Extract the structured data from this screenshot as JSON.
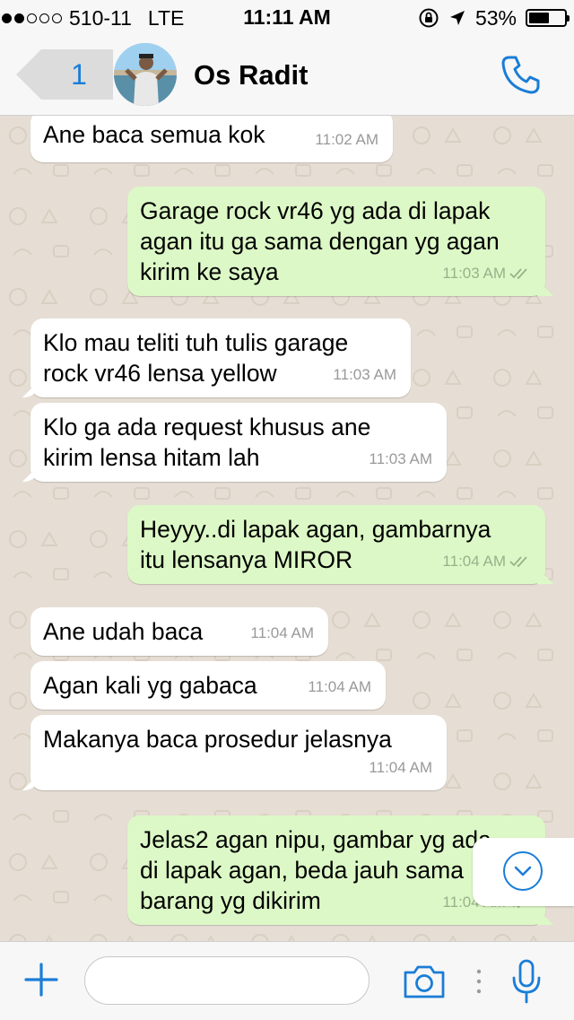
{
  "status_bar": {
    "carrier": "510-11",
    "network": "LTE",
    "time": "11:11 AM",
    "battery": "53%",
    "signal_bars_filled": 2,
    "signal_bars_total": 5
  },
  "header": {
    "back_count": "1",
    "contact_name": "Os Radit"
  },
  "messages": [
    {
      "direction": "in",
      "lines": [
        "Ane baca semua kok"
      ],
      "time": "11:02 AM"
    },
    {
      "direction": "out",
      "lines": [
        "Garage rock vr46 yg ada di lapak",
        "agan itu ga sama dengan yg agan",
        "kirim ke saya"
      ],
      "time": "11:03 AM",
      "read": true
    },
    {
      "direction": "in",
      "lines": [
        "Klo mau teliti tuh tulis garage",
        "rock vr46 lensa yellow"
      ],
      "time": "11:03 AM"
    },
    {
      "direction": "in",
      "lines": [
        "Klo ga ada request khusus ane",
        "kirim lensa hitam lah"
      ],
      "time": "11:03 AM"
    },
    {
      "direction": "out",
      "lines": [
        "Heyyy..di lapak agan, gambarnya",
        "itu lensanya MIROR"
      ],
      "time": "11:04 AM",
      "read": true
    },
    {
      "direction": "in",
      "lines": [
        "Ane udah baca"
      ],
      "time": "11:04 AM"
    },
    {
      "direction": "in",
      "lines": [
        "Agan kali yg gabaca"
      ],
      "time": "11:04 AM"
    },
    {
      "direction": "in",
      "lines": [
        "Makanya baca prosedur jelasnya"
      ],
      "time": "11:04 AM"
    },
    {
      "direction": "out",
      "lines": [
        "Jelas2 agan nipu, gambar yg ada",
        "di lapak agan, beda jauh sama",
        "barang yg dikirim"
      ],
      "time": "11:04 AM",
      "read": true
    }
  ],
  "input": {
    "placeholder": "",
    "value": ""
  },
  "icons": {
    "call": "phone-icon",
    "attach": "plus-icon",
    "camera": "camera-icon",
    "mic": "microphone-icon",
    "scroll_down": "chevron-down-icon"
  },
  "colors": {
    "accent": "#1a7dd7",
    "outgoing_bubble": "#dcf8c6",
    "incoming_bubble": "#ffffff",
    "chat_background": "#e6ded4"
  }
}
